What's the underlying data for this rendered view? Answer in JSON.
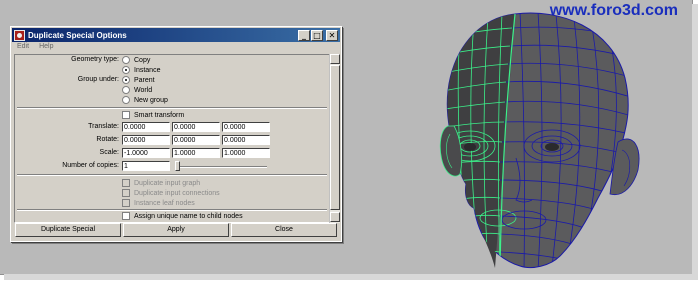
{
  "watermark": "www.foro3d.com",
  "dialog": {
    "title": "Duplicate Special Options",
    "menu": [
      "Edit",
      "Help"
    ],
    "window_buttons": {
      "minimize": "_",
      "maximize": "□",
      "close": "✕"
    },
    "geometry_type": {
      "label": "Geometry type:",
      "options": [
        "Copy",
        "Instance"
      ],
      "selected": "Instance"
    },
    "group_under": {
      "label": "Group under:",
      "options": [
        "Parent",
        "World",
        "New group"
      ],
      "selected": "Parent"
    },
    "smart_transform": {
      "label": "Smart transform",
      "checked": false
    },
    "translate": {
      "label": "Translate:",
      "values": [
        "0.0000",
        "0.0000",
        "0.0000"
      ]
    },
    "rotate": {
      "label": "Rotate:",
      "values": [
        "0.0000",
        "0.0000",
        "0.0000"
      ]
    },
    "scale": {
      "label": "Scale:",
      "values": [
        "-1.0000",
        "1.0000",
        "1.0000"
      ]
    },
    "number_of_copies": {
      "label": "Number of copies:",
      "value": "1"
    },
    "disabled_options": [
      "Duplicate input graph",
      "Duplicate input connections",
      "Instance leaf nodes"
    ],
    "assign_unique": {
      "label": "Assign unique name to child nodes",
      "checked": false
    },
    "buttons": {
      "duplicate": "Duplicate Special",
      "apply": "Apply",
      "close": "Close"
    }
  },
  "colors": {
    "title_start": "#0a246a",
    "title_end": "#3a6ea5",
    "wire_green": "#3cf08a",
    "wire_blue": "#1a1aa8",
    "viewport_bg": "#b9b9b9"
  }
}
